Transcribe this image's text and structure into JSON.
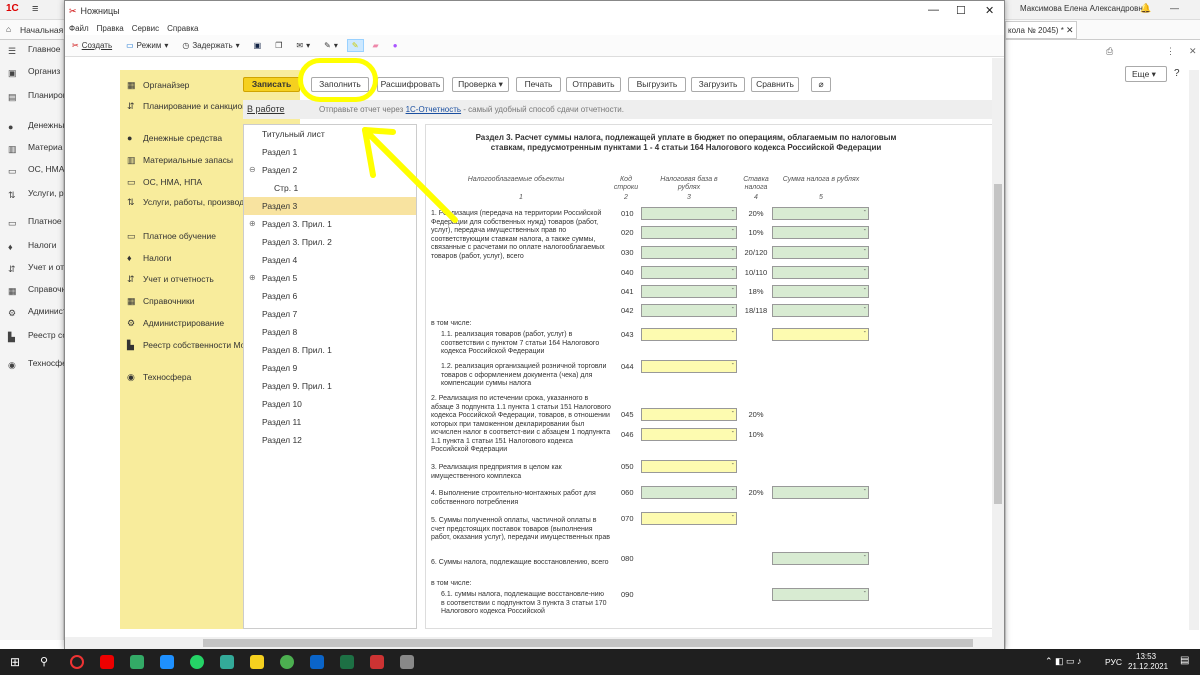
{
  "background_app": {
    "topbar_user": "Максимова Елена Александровна",
    "home_label": "Начальная",
    "tab_title": "кола № 2045) *",
    "more_button": "Еще",
    "nav": [
      "Главное",
      "Организ",
      "Планиров санкцион",
      "Денежны",
      "Материа",
      "ОС, НМА",
      "Услуги, р производ",
      "Платное о",
      "Налоги",
      "Учет и от",
      "Справочн",
      "Админист",
      "Реестр со Москвы",
      "Техносфе"
    ]
  },
  "snip": {
    "title": "Ножницы",
    "menu": [
      "Файл",
      "Правка",
      "Сервис",
      "Справка"
    ],
    "toolbar": {
      "new": "Создать",
      "mode": "Режим",
      "delay": "Задержать"
    }
  },
  "nav_items": [
    "Органайзер",
    "Планирование и санкционирование",
    "Денежные средства",
    "Материальные запасы",
    "ОС, НМА, НПА",
    "Услуги, работы, производство",
    "Платное обучение",
    "Налоги",
    "Учет и отчетность",
    "Справочники",
    "Администрирование",
    "Реестр собственности Москвы",
    "Техносфера"
  ],
  "toolbar": {
    "save": "Записать",
    "fill": "Заполнить",
    "decode": "Расшифровать",
    "check": "Проверка",
    "print": "Печать",
    "send": "Отправить",
    "export": "Выгрузить",
    "load": "Загрузить",
    "compare": "Сравнить"
  },
  "status": {
    "state": "В работе",
    "hint_pre": "Отправьте отчет через ",
    "hint_link": "1С-Отчетность",
    "hint_post": " - самый удобный способ сдачи отчетности."
  },
  "sections": [
    {
      "label": "Титульный лист",
      "exp": ""
    },
    {
      "label": "Раздел 1",
      "exp": ""
    },
    {
      "label": "Раздел 2",
      "exp": "⊖"
    },
    {
      "label": "Стр. 1",
      "exp": ""
    },
    {
      "label": "Раздел 3",
      "exp": ""
    },
    {
      "label": "Раздел 3. Прил. 1",
      "exp": "⊕"
    },
    {
      "label": "Раздел 3. Прил. 2",
      "exp": ""
    },
    {
      "label": "Раздел 4",
      "exp": ""
    },
    {
      "label": "Раздел 5",
      "exp": "⊕"
    },
    {
      "label": "Раздел 6",
      "exp": ""
    },
    {
      "label": "Раздел 7",
      "exp": ""
    },
    {
      "label": "Раздел 8",
      "exp": ""
    },
    {
      "label": "Раздел 8. Прил. 1",
      "exp": ""
    },
    {
      "label": "Раздел 9",
      "exp": ""
    },
    {
      "label": "Раздел 9. Прил. 1",
      "exp": ""
    },
    {
      "label": "Раздел 10",
      "exp": ""
    },
    {
      "label": "Раздел 11",
      "exp": ""
    },
    {
      "label": "Раздел 12",
      "exp": ""
    }
  ],
  "form": {
    "title": "Раздел 3. Расчет суммы налога, подлежащей уплате в бюджет по операциям, облагаемым по налоговым ставкам, предусмотренным пунктами 1 - 4 статьи 164 Налогового кодекса Российской Федерации",
    "col_objects": "Налогооблагаемые объекты",
    "col_code": "Код строки",
    "col_base": "Налоговая база в рублях",
    "col_rate": "Ставка налога",
    "col_sum": "Сумма налога в рублях",
    "col_nums": [
      "1",
      "2",
      "3",
      "4",
      "5"
    ],
    "text1": "1. Реализация (передача на территории Российской Федерации для собственных нужд) товаров (работ, услуг), передача имущественных прав по соответствующим ставкам налога, а также суммы, связанные с расчетами по оплате налогооблагаемых товаров (работ, услуг), всего",
    "incl": "в том числе:",
    "text11": "1.1. реализация товаров (работ, услуг) в соответствии с пунктом 7 статьи 164 Налогового кодекса Российской Федерации",
    "text12": "1.2. реализация организацией розничной торговли товаров с оформлением документа (чека) для компенсации суммы налога",
    "text2": "2. Реализация по истечении срока, указанного в абзаце 3 подпункта 1.1 пункта 1 статьи 151 Налогового кодекса Российской Федерации, товаров, в отношении которых при таможенном декларировании был исчислен налог в соответст-вии с абзацем 1 подпункта 1.1 пункта 1 статьи 151 Налогового кодекса Российской Федерации",
    "text3": "3. Реализация предприятия в целом как имущественного комплекса",
    "text4": "4. Выполнение строительно-монтажных работ для собственного потребления",
    "text5": "5. Суммы полученной оплаты, частичной оплаты в счет предстоящих поставок товаров (выполнения работ, оказания услуг), передачи имущественных прав",
    "text6": "6. Суммы налога, подлежащие восстановлению, всего",
    "incl2": "в том числе:",
    "text61": "6.1. суммы налога, подлежащие восстановле-нию в соответствии с подпунктом 3 пункта 3 статьи 170 Налогового кодекса Российской",
    "rows": [
      {
        "code": "010",
        "rate": "20%"
      },
      {
        "code": "020",
        "rate": "10%"
      },
      {
        "code": "030",
        "rate": "20/120"
      },
      {
        "code": "040",
        "rate": "10/110"
      },
      {
        "code": "041",
        "rate": "18%"
      },
      {
        "code": "042",
        "rate": "18/118"
      },
      {
        "code": "043",
        "rate": ""
      },
      {
        "code": "044",
        "rate": ""
      },
      {
        "code": "045",
        "rate": "20%"
      },
      {
        "code": "046",
        "rate": "10%"
      },
      {
        "code": "050",
        "rate": ""
      },
      {
        "code": "060",
        "rate": "20%"
      },
      {
        "code": "070",
        "rate": ""
      },
      {
        "code": "080",
        "rate": ""
      },
      {
        "code": "090",
        "rate": ""
      }
    ]
  },
  "taskbar": {
    "lang": "РУС",
    "time": "13:53",
    "date": "21.12.2021"
  }
}
